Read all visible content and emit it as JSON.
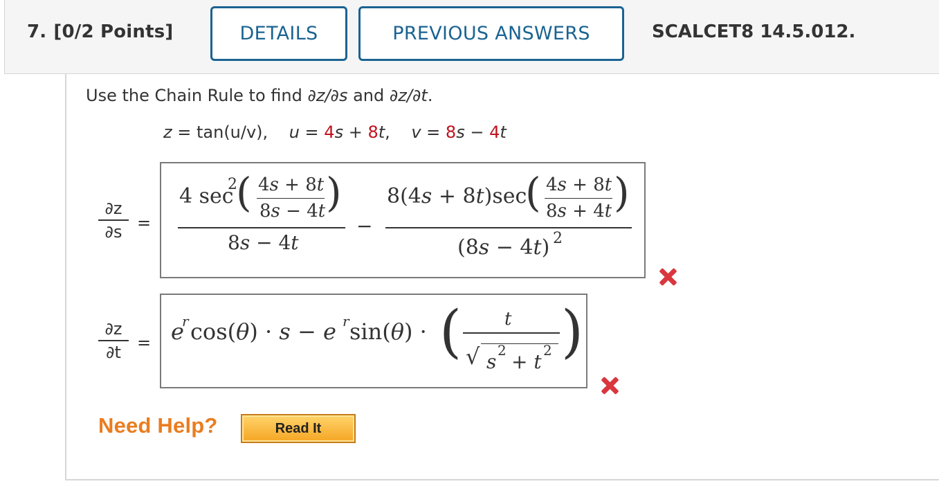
{
  "question": {
    "number": "7.",
    "points": "[0/2 Points]",
    "details_label": "DETAILS",
    "previous_answers_label": "PREVIOUS ANSWERS",
    "code": "SCALCET8 14.5.012."
  },
  "problem": {
    "instruction_prefix": "Use the Chain Rule to find ",
    "instruction_dzds": "∂z/∂s",
    "instruction_and": " and ",
    "instruction_dzdt": "∂z/∂t",
    "instruction_suffix": ".",
    "z_def": "tan(u/v)",
    "u_coef_s": "4",
    "u_coef_t": "8",
    "v_coef_s": "8",
    "v_coef_t": "4"
  },
  "answers": {
    "dzds_label_num": "∂z",
    "dzds_label_den": "∂s",
    "dzdt_label_num": "∂z",
    "dzdt_label_den": "∂t",
    "equals": "=",
    "dzds_status": "incorrect",
    "dzdt_status": "incorrect",
    "dzds_text": "4 sec^2((4s + 8t)/(8s − 4t))/(8s − 4t) − 8(4s + 8t)sec((4s + 8t)/(8s + 4t))/(8s − 4t)^2",
    "dzdt_text": "e^r cos(θ)·s − e^r sin(θ)·(t/√(s^2 + t^2))"
  },
  "help": {
    "need_help_label": "Need Help?",
    "read_it_label": "Read It"
  },
  "colors": {
    "accent": "#1a6392",
    "given_constant": "#c0121d",
    "wrong": "#d9363e",
    "help": "#ea7d20"
  }
}
